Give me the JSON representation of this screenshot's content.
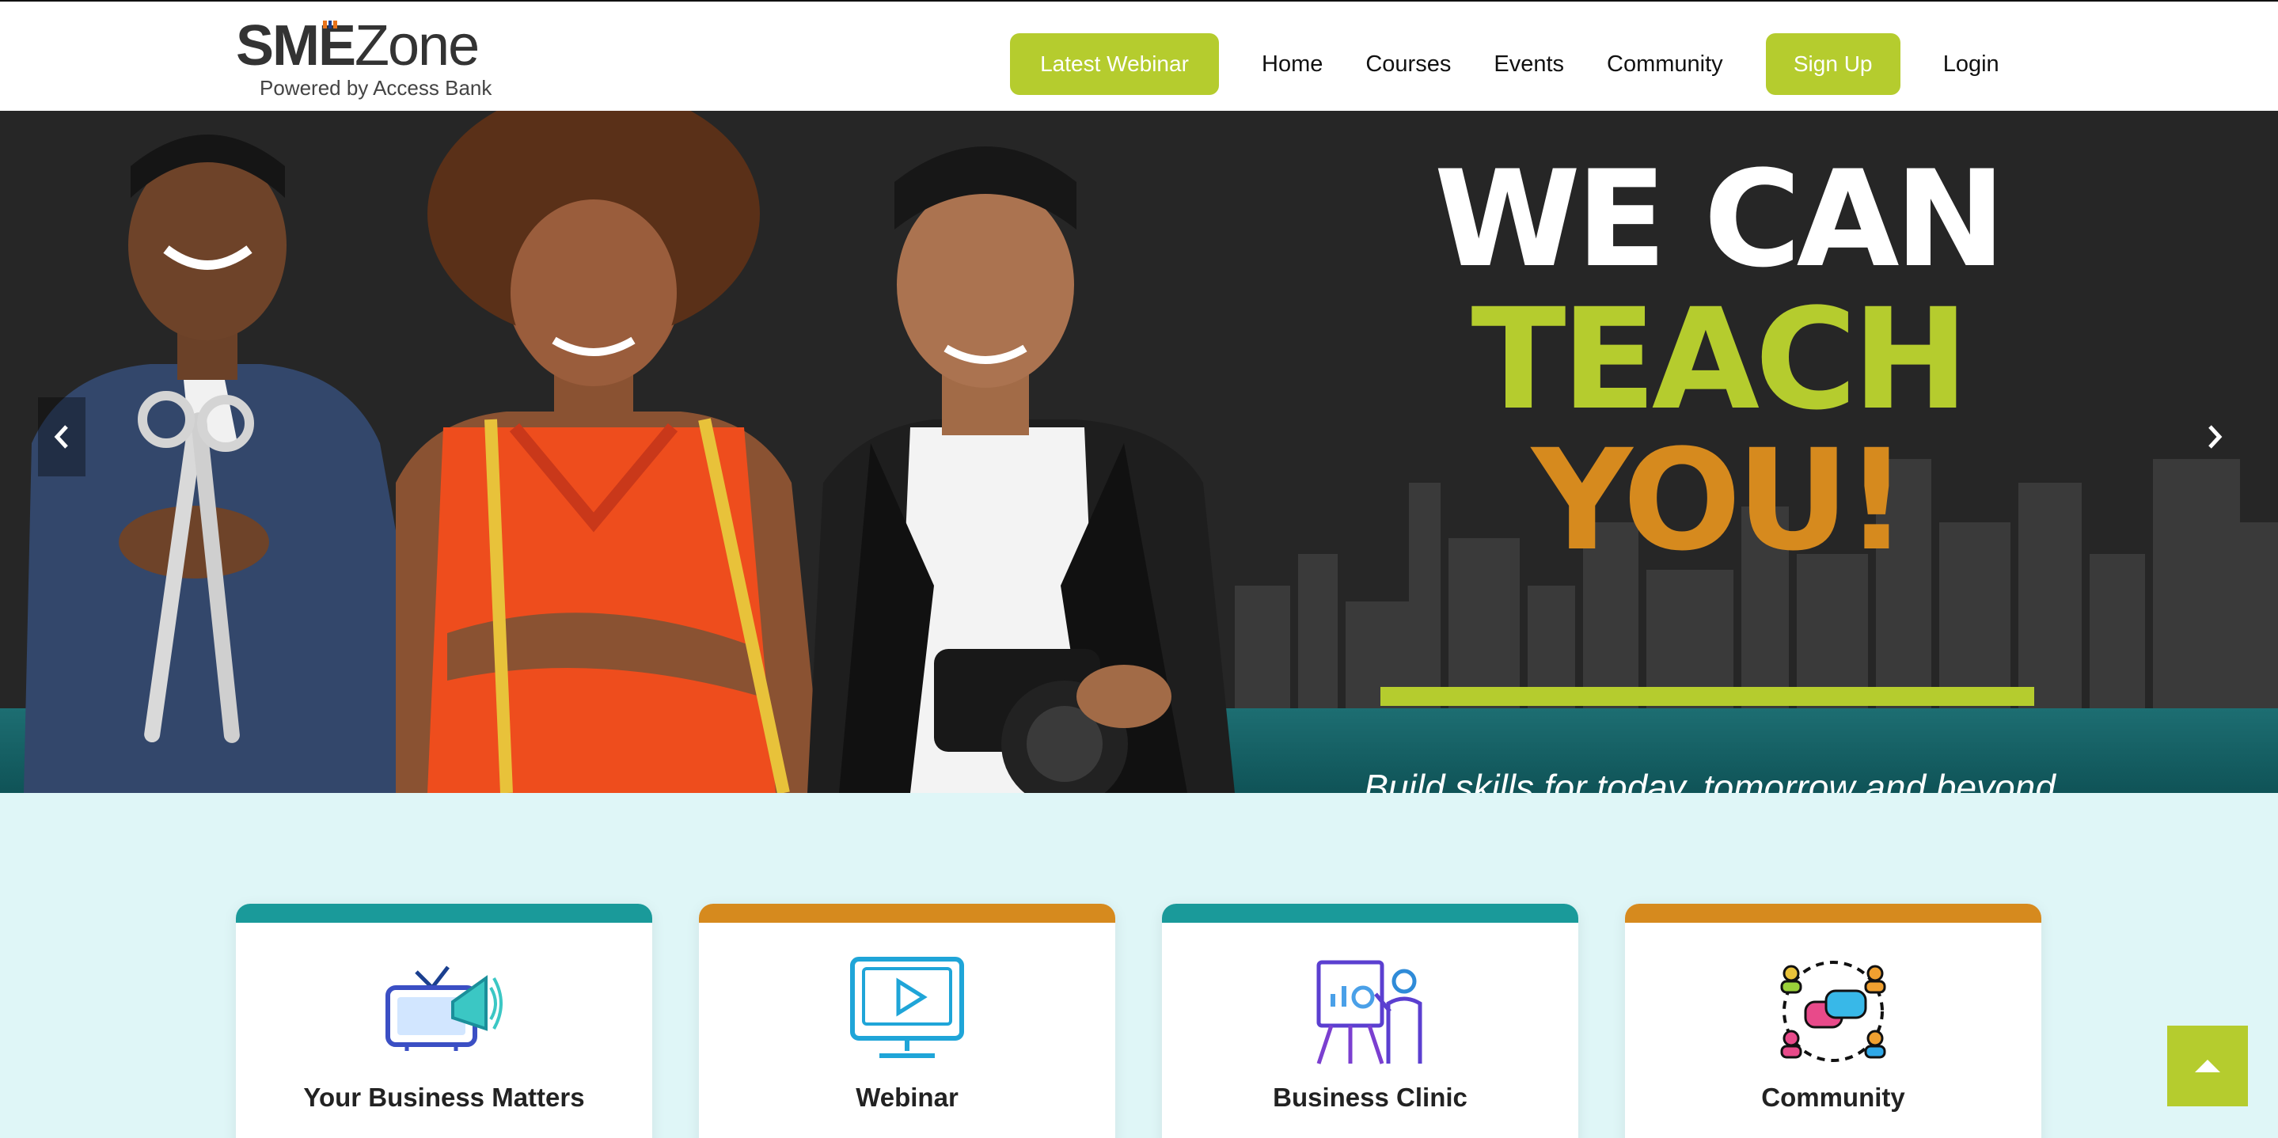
{
  "brand": {
    "name_bold": "SME",
    "name_light": "Zone",
    "tagline": "Powered by Access Bank",
    "colors": {
      "green": "#b5cc2e",
      "orange": "#d68a1e",
      "teal": "#1a9a9a",
      "dark": "#262626"
    }
  },
  "nav": {
    "latest_webinar": "Latest Webinar",
    "home": "Home",
    "courses": "Courses",
    "events": "Events",
    "community": "Community",
    "sign_up": "Sign Up",
    "login": "Login"
  },
  "hero": {
    "line1": "WE CAN",
    "line2": "TEACH",
    "line3": "YOU!",
    "tagline": "Build skills for today, tomorrow and beyond",
    "prev_icon": "chevron-left-icon",
    "next_icon": "chevron-right-icon"
  },
  "services": [
    {
      "title": "Your Business Matters",
      "icon": "tv-megaphone-icon",
      "accent": "#1a9a9a"
    },
    {
      "title": "Webinar",
      "icon": "monitor-play-icon",
      "accent": "#d68a1e"
    },
    {
      "title": "Business Clinic",
      "icon": "presentation-icon",
      "accent": "#1a9a9a"
    },
    {
      "title": "Community",
      "icon": "community-chat-icon",
      "accent": "#d68a1e"
    }
  ],
  "back_to_top_icon": "caret-up-icon"
}
